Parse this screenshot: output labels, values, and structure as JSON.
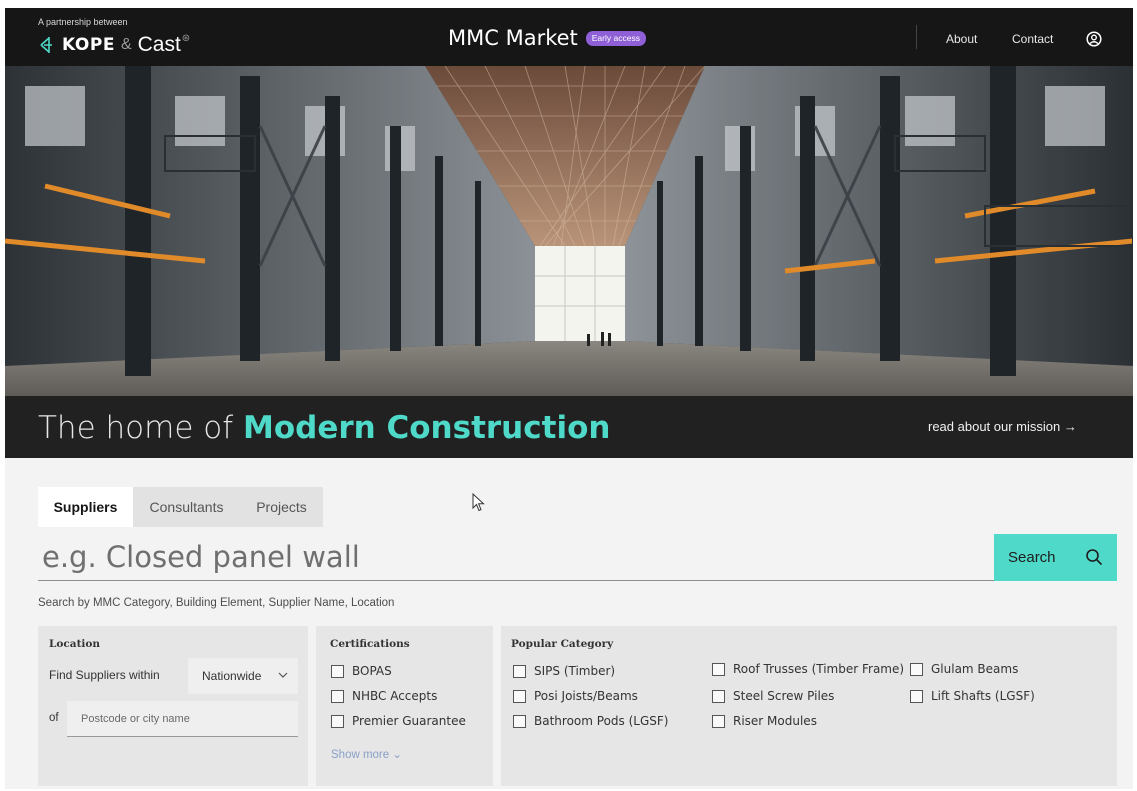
{
  "header": {
    "partnership_text": "A partnership between",
    "logo_kope": "KOPE",
    "logo_amp": "&",
    "logo_cast": "Cast",
    "site_name": "MMC Market",
    "badge": "Early access",
    "nav": [
      {
        "label": "About"
      },
      {
        "label": "Contact"
      }
    ],
    "user_icon": "user-circle-icon"
  },
  "hero": {
    "title_plain": "The home of",
    "title_highlight": "Modern Construction",
    "mission_link": "read about our mission",
    "mission_arrow": "→",
    "highlight_color": "#4fd9c8"
  },
  "search": {
    "tabs": [
      {
        "label": "Suppliers",
        "active": true
      },
      {
        "label": "Consultants",
        "active": false
      },
      {
        "label": "Projects",
        "active": false
      }
    ],
    "placeholder": "e.g. Closed panel wall",
    "button_label": "Search",
    "hint": "Search by MMC Category, Building Element, Supplier Name, Location",
    "accent_color": "#4fd9c8"
  },
  "filters": {
    "location": {
      "title": "Location",
      "find_label": "Find Suppliers within",
      "radius_value": "Nationwide",
      "of_label": "of",
      "postcode_placeholder": "Postcode or city name"
    },
    "certifications": {
      "title": "Certifications",
      "items": [
        "BOPAS",
        "NHBC Accepts",
        "Premier Guarantee"
      ],
      "show_more": "Show more"
    },
    "popular_category": {
      "title": "Popular Category",
      "items": [
        "SIPS (Timber)",
        "Posi Joists/Beams",
        "Bathroom Pods (LGSF)",
        "Roof Trusses (Timber Frame)",
        "Steel Screw Piles",
        "Riser Modules",
        "Glulam Beams",
        "Lift Shafts (LGSF)"
      ]
    }
  }
}
